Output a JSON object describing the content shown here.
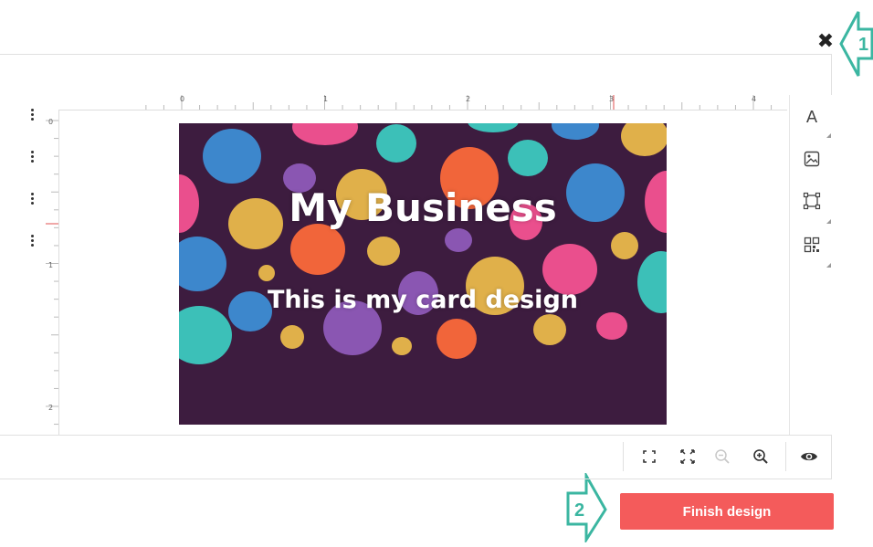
{
  "header": {
    "close_icon": "close-icon"
  },
  "callouts": [
    {
      "number": "1"
    },
    {
      "number": "2"
    }
  ],
  "callout_color": "#3bb6a1",
  "ruler": {
    "top_labels": [
      "0",
      "1",
      "2",
      "3",
      "4"
    ],
    "left_labels": [
      "0",
      "1",
      "2"
    ]
  },
  "card": {
    "title": "My Business",
    "subtitle": "This is my card design",
    "background_color": "#3d1c3f"
  },
  "right_toolbar": {
    "items": [
      {
        "icon": "text-icon",
        "glyph": "A"
      },
      {
        "icon": "image-icon"
      },
      {
        "icon": "shape-icon"
      },
      {
        "icon": "qr-code-icon"
      }
    ]
  },
  "bottom_toolbar": {
    "items": [
      {
        "icon": "fit-to-screen-icon"
      },
      {
        "icon": "fullscreen-icon"
      },
      {
        "icon": "zoom-out-icon",
        "disabled": true
      },
      {
        "icon": "zoom-in-icon"
      },
      {
        "icon": "preview-eye-icon"
      }
    ]
  },
  "actions": {
    "finish_label": "Finish design",
    "finish_color": "#f45b5b"
  }
}
